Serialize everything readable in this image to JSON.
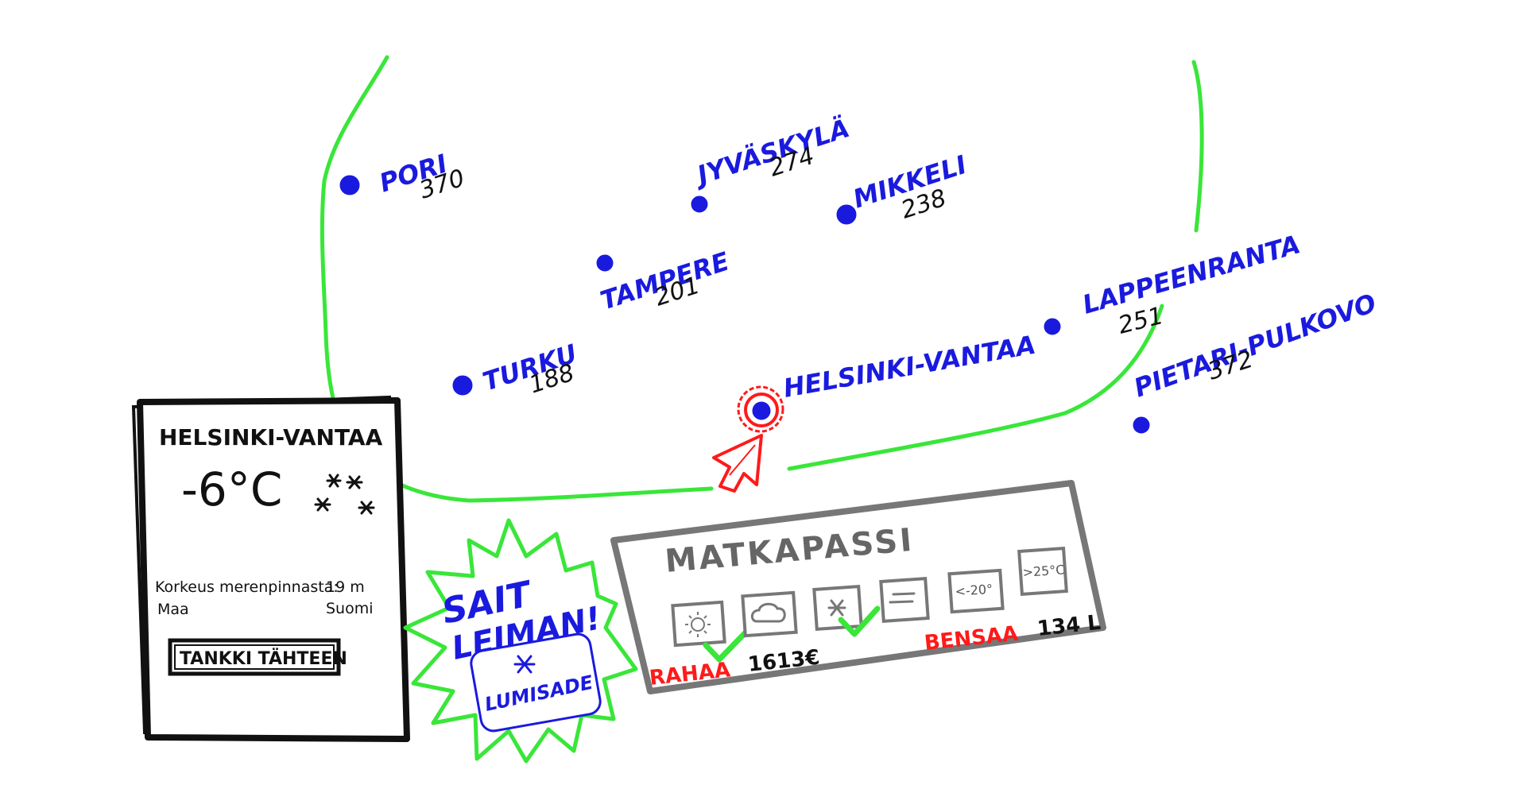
{
  "colors": {
    "route": "#39e639",
    "city": "#1a1adf",
    "selected": "#ff1a1a",
    "panel": "#777777",
    "stat_label": "#ff1a1a"
  },
  "map": {
    "cities": [
      {
        "id": "pori",
        "name": "PORI",
        "distance": "370"
      },
      {
        "id": "jyvaskyla",
        "name": "JYVÄSKYLÄ",
        "distance": "274"
      },
      {
        "id": "mikkeli",
        "name": "MIKKELI",
        "distance": "238"
      },
      {
        "id": "tampere",
        "name": "TAMPERE",
        "distance": "201"
      },
      {
        "id": "lappeenranta",
        "name": "LAPPEENRANTA",
        "distance": "251"
      },
      {
        "id": "turku",
        "name": "TURKU",
        "distance": "188"
      },
      {
        "id": "helsinki",
        "name": "HELSINKI-VANTAA",
        "distance": ""
      },
      {
        "id": "pietari",
        "name": "PIETARI-PULKOVO",
        "distance": "372"
      }
    ]
  },
  "weather": {
    "airport": "HELSINKI-VANTAA",
    "temperature": "-6°C",
    "icon": "snowflakes-icon",
    "elevation_label": "Korkeus merenpinnasta:",
    "elevation_value": "19 m",
    "country_label": "Maa",
    "country_value": "Suomi",
    "refuel_button": "TANKKI TÄHTEEN"
  },
  "stamp": {
    "line1": "SAIT",
    "line2": "LEIMAN!",
    "stamp_name": "LUMISADE",
    "icon": "snowflake-icon"
  },
  "passport": {
    "title": "MATKAPASSI",
    "badges": [
      {
        "icon": "sun-icon",
        "label": "",
        "collected": true
      },
      {
        "icon": "cloud-icon",
        "label": "",
        "collected": false
      },
      {
        "icon": "snowflake-icon",
        "label": "",
        "collected": true
      },
      {
        "icon": "fog-icon",
        "label": "",
        "collected": false
      },
      {
        "icon": "cold-icon",
        "label": "<-20°",
        "collected": false
      },
      {
        "icon": "hot-icon",
        "label": ">25°C",
        "collected": false
      }
    ],
    "money_label": "RAHAA",
    "money_value": "1613€",
    "fuel_label": "BENSAA",
    "fuel_value": "134 L"
  }
}
